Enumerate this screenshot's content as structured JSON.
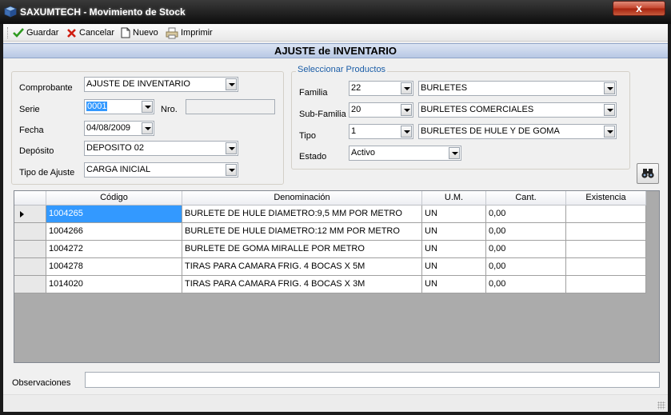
{
  "window": {
    "title": "SAXUMTECH - Movimiento de Stock",
    "close_glyph": "x"
  },
  "toolbar": {
    "save_label": "Guardar",
    "cancel_label": "Cancelar",
    "new_label": "Nuevo",
    "print_label": "Imprimir"
  },
  "form_title": "AJUSTE de INVENTARIO",
  "left_form": {
    "comprobante_label": "Comprobante",
    "comprobante_value": "AJUSTE DE INVENTARIO",
    "serie_label": "Serie",
    "serie_value": "0001",
    "nro_label": "Nro.",
    "nro_value": "",
    "fecha_label": "Fecha",
    "fecha_value": "04/08/2009",
    "deposito_label": "Depósito",
    "deposito_value": "DEPOSITO 02",
    "tipo_ajuste_label": "Tipo de Ajuste",
    "tipo_ajuste_value": "CARGA INICIAL"
  },
  "product_selector": {
    "legend": "Seleccionar Productos",
    "familia_label": "Familia",
    "familia_code": "22",
    "familia_name": "BURLETES",
    "subfamilia_label": "Sub-Familia",
    "subfamilia_code": "20",
    "subfamilia_name": "BURLETES COMERCIALES",
    "tipo_label": "Tipo",
    "tipo_code": "1",
    "tipo_name": "BURLETES DE HULE Y DE GOMA",
    "estado_label": "Estado",
    "estado_value": "Activo"
  },
  "grid": {
    "columns": [
      "Código",
      "Denominación",
      "U.M.",
      "Cant.",
      "Existencia"
    ],
    "rows": [
      {
        "codigo": "1004265",
        "denominacion": "BURLETE DE HULE DIAMETRO:9,5 MM POR METRO",
        "um": "UN",
        "cant": "0,00",
        "existencia": ""
      },
      {
        "codigo": "1004266",
        "denominacion": "BURLETE DE HULE DIAMETRO:12 MM POR METRO",
        "um": "UN",
        "cant": "0,00",
        "existencia": ""
      },
      {
        "codigo": "1004272",
        "denominacion": "BURLETE DE GOMA MIRALLE POR METRO",
        "um": "UN",
        "cant": "0,00",
        "existencia": ""
      },
      {
        "codigo": "1004278",
        "denominacion": "TIRAS PARA CAMARA FRIG. 4 BOCAS X 5M",
        "um": "UN",
        "cant": "0,00",
        "existencia": ""
      },
      {
        "codigo": "1014020",
        "denominacion": "TIRAS PARA CAMARA FRIG. 4 BOCAS X 3M",
        "um": "UN",
        "cant": "0,00",
        "existencia": ""
      }
    ]
  },
  "observaciones": {
    "label": "Observaciones",
    "value": ""
  },
  "icons": {
    "save": "check-icon",
    "cancel": "x-icon",
    "new": "document-icon",
    "print": "printer-icon",
    "search": "binoculars-icon"
  },
  "colors": {
    "selection": "#3399ff",
    "legend": "#1c5ea7",
    "header_band": "#b8c8e4"
  }
}
